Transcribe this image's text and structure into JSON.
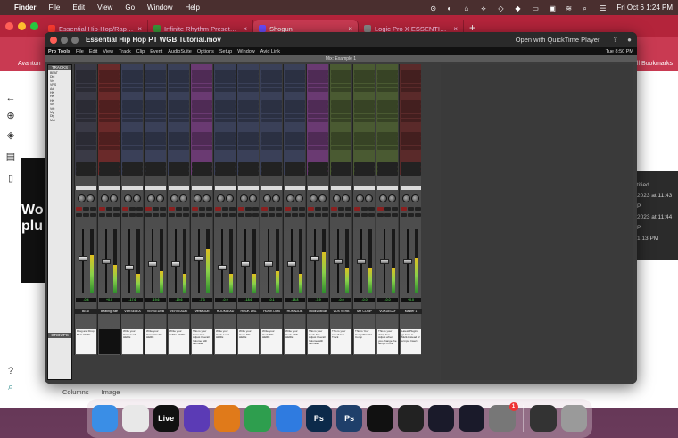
{
  "menubar": {
    "app": "Finder",
    "items": [
      "File",
      "Edit",
      "View",
      "Go",
      "Window",
      "Help"
    ],
    "datetime": "Fri Oct 6  1:24 PM"
  },
  "browser": {
    "tabs": [
      {
        "title": "Essential Hip-Hop/Rap Vocal P",
        "color": "#ff3b30"
      },
      {
        "title": "Infinite Rhythm Presets - Prod",
        "color": "#3a9a3a"
      },
      {
        "title": "Shogun",
        "color": "#6a4cff"
      },
      {
        "title": "Logic Pro X ESSENTIAL Hip Ho",
        "color": "#888888"
      }
    ],
    "bookmarks_left": "Avanton",
    "bookmarks_right": "All Bookmarks",
    "left_text": "Wo\nplu",
    "right_panel": [
      "tified",
      "2023 at 11:43 P",
      "2023 at 11:44 P",
      "1:13 PM"
    ],
    "bottom_tabs": [
      "Columns",
      "Image"
    ]
  },
  "quicktime": {
    "title": "Essential Hip Hop PT WGB Tutorial.mov",
    "open_button": "Open with QuickTime Player"
  },
  "protools": {
    "menu": [
      "Pro Tools",
      "File",
      "Edit",
      "View",
      "Track",
      "Clip",
      "Event",
      "AudioSuite",
      "Options",
      "Setup",
      "Window",
      "Avid Link"
    ],
    "clock": "Tue 8:50 PM",
    "window_title": "Mix: Example 1",
    "tracks_header": "TRACKS",
    "groups_header": "GROUPS",
    "track_list": [
      "BEAT",
      "Dbl",
      "Vrs",
      "VRS",
      "Adl",
      "HK",
      "HK",
      "HK",
      "Sh",
      "Vrb",
      "My",
      "Dly",
      "Mst"
    ],
    "strips": [
      {
        "name": "BEAT",
        "color": "#3a3a46",
        "vol": "-0.4",
        "comment": "Drag and Drop Beat HERE",
        "fader": 0.55,
        "meter": 0.6
      },
      {
        "name": "BeatingTrae",
        "color": "#6a2a2a",
        "vol": "+0.0",
        "comment": "",
        "fader": 0.5,
        "meter": 0.45
      },
      {
        "name": "VERSELEA",
        "color": "#3a4058",
        "vol": "-17.6",
        "comment": "Write your Verse lead HERE",
        "fader": 0.4,
        "meter": 0.3
      },
      {
        "name": "VERSEDUB",
        "color": "#3a4058",
        "vol": "-19.6",
        "comment": "Write your Verse Double HERE",
        "fader": 0.45,
        "meter": 0.35
      },
      {
        "name": "VERSEADLI",
        "color": "#3a4058",
        "vol": "-19.6",
        "comment": "Write your Adlibs HERE",
        "fader": 0.45,
        "meter": 0.3
      },
      {
        "name": "VerseDUb",
        "color": "#6a3a72",
        "vol": "-7.3",
        "comment": "This is your Verse bus. Adjust Overall Volume with this fader",
        "fader": 0.55,
        "meter": 0.7
      },
      {
        "name": "HOOKLEAD",
        "color": "#3a4058",
        "vol": "-0.9",
        "comment": "Write your Hook Lead HERE",
        "fader": 0.4,
        "meter": 0.3
      },
      {
        "name": "HOOK DBL",
        "color": "#3a4058",
        "vol": "-18.6",
        "comment": "Write your Hook Dbl HERE",
        "fader": 0.45,
        "meter": 0.3
      },
      {
        "name": "HOOK DUB",
        "color": "#3a4058",
        "vol": "-0.1",
        "comment": "Write your Hook Dbl HERE",
        "fader": 0.45,
        "meter": 0.35
      },
      {
        "name": "HOKADLIB",
        "color": "#3a4058",
        "vol": "-18.8",
        "comment": "Write your Hook adlib HERE",
        "fader": 0.45,
        "meter": 0.3
      },
      {
        "name": "HookVoxBub",
        "color": "#6a3a72",
        "vol": "-7.9",
        "comment": "This is your Hook bus. Adjust Overall Volume with this fader",
        "fader": 0.55,
        "meter": 0.65
      },
      {
        "name": "VOX VERB",
        "color": "#4a5a32",
        "vol": "-0.0",
        "comment": "This is your reverb bus Track",
        "fader": 0.5,
        "meter": 0.4
      },
      {
        "name": "MY COMP",
        "color": "#4a5a32",
        "vol": "-0.0",
        "comment": "This is Your Comp/Parallel Comp",
        "fader": 0.5,
        "meter": 0.4
      },
      {
        "name": "VOXDELAY",
        "color": "#4a5a32",
        "vol": "-0.0",
        "comment": "This is your delay bus. Adjust when you change the tempo in the",
        "fader": 0.5,
        "meter": 0.4
      },
      {
        "name": "Master 1",
        "color": "#5a2a2a",
        "vol": "+0.0",
        "comment": "Latest Plugins go here in Multi-Instead of a Input Insert",
        "fader": 0.5,
        "meter": 0.55
      }
    ]
  },
  "dock": [
    {
      "name": "Finder",
      "color": "#3a8ee6",
      "icon": "finder-icon",
      "label": ""
    },
    {
      "name": "Chrome",
      "color": "#e8e8e8",
      "icon": "chrome-icon",
      "label": ""
    },
    {
      "name": "Live",
      "color": "#111111",
      "icon": "ableton-live-icon",
      "label": "Live"
    },
    {
      "name": "Pro Tools",
      "color": "#5b3bb5",
      "icon": "pro-tools-icon",
      "label": ""
    },
    {
      "name": "FL Studio",
      "color": "#e07a1a",
      "icon": "fl-studio-icon",
      "label": ""
    },
    {
      "name": "Sheets",
      "color": "#2e9e4e",
      "icon": "sheets-icon",
      "label": ""
    },
    {
      "name": "Cloud",
      "color": "#2f7be0",
      "icon": "cloud-icon",
      "label": ""
    },
    {
      "name": "Photoshop",
      "color": "#0c2a4a",
      "icon": "photoshop-icon",
      "label": "Ps"
    },
    {
      "name": "Photoshop 2",
      "color": "#1f3f6a",
      "icon": "photoshop-icon",
      "label": "Ps"
    },
    {
      "name": "Splice",
      "color": "#111111",
      "icon": "splice-icon",
      "label": ""
    },
    {
      "name": "Final Cut",
      "color": "#222222",
      "icon": "final-cut-icon",
      "label": ""
    },
    {
      "name": "Console",
      "color": "#1a1a2a",
      "icon": "mixer-console-icon",
      "label": ""
    },
    {
      "name": "UA Connect",
      "color": "#1a1a2a",
      "icon": "ua-icon",
      "label": ""
    },
    {
      "name": "Settings",
      "color": "#777777",
      "icon": "settings-icon",
      "label": "",
      "badge": "1"
    },
    {
      "name": "Screen",
      "color": "#333333",
      "icon": "screen-icon",
      "label": ""
    },
    {
      "name": "Trash",
      "color": "#9a9a9a",
      "icon": "trash-icon",
      "label": ""
    }
  ]
}
